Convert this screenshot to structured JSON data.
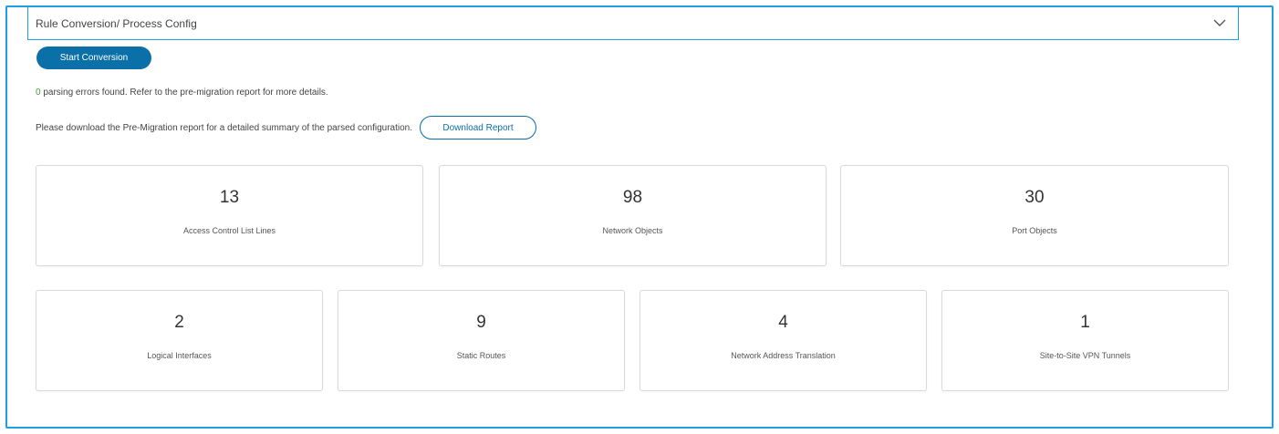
{
  "section": {
    "title": "Rule Conversion/ Process Config"
  },
  "actions": {
    "start_label": "Start Conversion",
    "download_label": "Download Report"
  },
  "messages": {
    "error_count": "0",
    "parse_text": "parsing errors found. Refer to the pre-migration report for more details.",
    "download_text": "Please download the Pre-Migration report for a detailed summary of the parsed configuration."
  },
  "colors": {
    "accent": "#1fa1e0",
    "primary_button": "#0b6fa8",
    "success": "#3fa23f"
  },
  "icons": {
    "section_toggle": "chevron-down-icon"
  },
  "stats_row1": [
    {
      "value": "13",
      "label": "Access Control List Lines"
    },
    {
      "value": "98",
      "label": "Network Objects"
    },
    {
      "value": "30",
      "label": "Port Objects"
    }
  ],
  "stats_row2": [
    {
      "value": "2",
      "label": "Logical Interfaces"
    },
    {
      "value": "9",
      "label": "Static Routes"
    },
    {
      "value": "4",
      "label": "Network Address Translation"
    },
    {
      "value": "1",
      "label": "Site-to-Site VPN Tunnels"
    }
  ]
}
